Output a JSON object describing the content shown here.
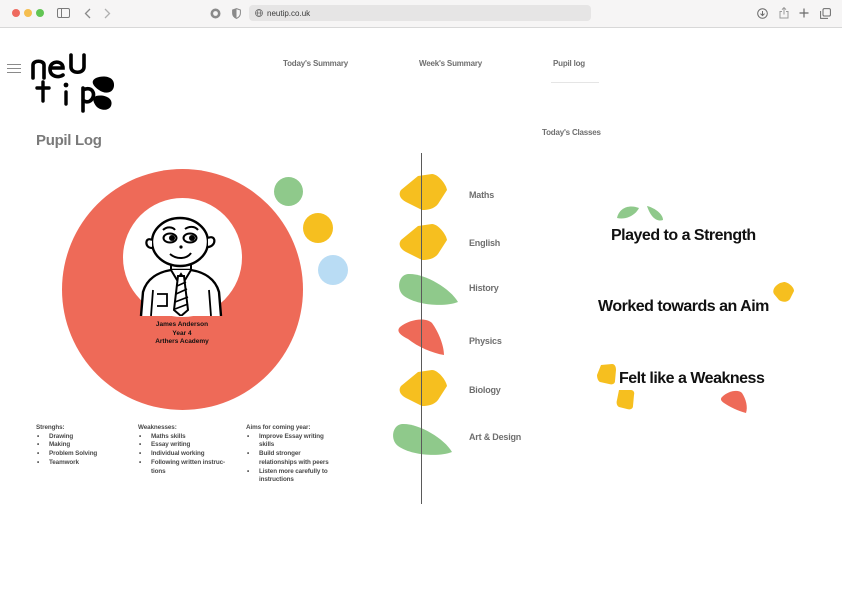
{
  "browser": {
    "url": "neutip.co.uk"
  },
  "nav": {
    "items": [
      {
        "label": "Today's Summary"
      },
      {
        "label": "Week's Summary"
      },
      {
        "label": "Pupil log"
      }
    ],
    "active": "Pupil log"
  },
  "page": {
    "title": "Pupil Log",
    "today_classes_label": "Today's Classes"
  },
  "pupil": {
    "name": "James Anderson",
    "year": "Year 4",
    "school": "Arthers Academy"
  },
  "strengths": {
    "title": "Strenghs:",
    "items": [
      "Drawing",
      "Making",
      "Problem Solving",
      "Teamwork"
    ]
  },
  "weaknesses": {
    "title": "Weaknesses:",
    "items": [
      "Maths skills",
      "Essay writing",
      "Individual working",
      "Following written instruc-tions"
    ]
  },
  "aims": {
    "title": "Aims for coming year:",
    "items": [
      "Improve Essay writing skills",
      "Build stronger relationships with peers",
      "Listen more carefully to instructions"
    ]
  },
  "classes": [
    {
      "label": "Maths",
      "shape": "diamond",
      "color": "#f6bf1f"
    },
    {
      "label": "English",
      "shape": "diamond",
      "color": "#f6bf1f"
    },
    {
      "label": "History",
      "shape": "leaf",
      "color": "#8fc98b"
    },
    {
      "label": "Physics",
      "shape": "leaf",
      "color": "#ee6a58"
    },
    {
      "label": "Biology",
      "shape": "diamond",
      "color": "#f6bf1f"
    },
    {
      "label": "Art & Design",
      "shape": "leaf",
      "color": "#8fc98b"
    }
  ],
  "feedback": {
    "strength": "Played to a Strength",
    "aim": "Worked towards an Aim",
    "weakness": "Felt like a Weakness"
  },
  "colors": {
    "red": "#ee6a58",
    "yellow": "#f6bf1f",
    "green": "#8fc98b",
    "blue": "#b9dcf4"
  }
}
